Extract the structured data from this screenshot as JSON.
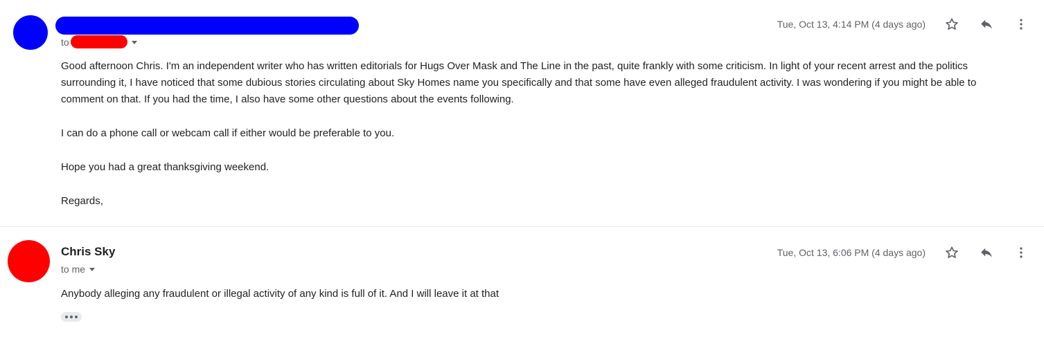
{
  "messages": [
    {
      "avatar_color": "#0000ff",
      "redaction_name_color": "#0000ff",
      "redaction_recipient_color": "#ff0000",
      "to_prefix": "to",
      "date": "Tue, Oct 13, 4:14 PM (4 days ago)",
      "paragraphs": [
        "Good afternoon Chris. I'm an independent writer who has written editorials for Hugs Over Mask and The Line in the past, quite frankly with some criticism. In light of your recent arrest and the politics surrounding it, I have noticed that some dubious stories circulating about Sky Homes name you specifically and that some have even alleged fraudulent activity. I was wondering if you might be able to comment on that. If you had the time, I also have some other questions about the events following.",
        "I can do a phone call or webcam call if either would be preferable to you.",
        "Hope you had a great thanksgiving weekend.",
        "Regards,"
      ],
      "icons": [
        "star-icon",
        "reply-icon",
        "more-vert-icon"
      ]
    },
    {
      "avatar_color": "#ff0000",
      "sender": "Chris Sky",
      "to_label": "to me",
      "date": "Tue, Oct 13, 6:06 PM (4 days ago)",
      "paragraphs": [
        "Anybody alleging any fraudulent or illegal activity of any kind is full of it.  And I will leave it at that"
      ],
      "icons": [
        "star-icon",
        "reply-icon",
        "more-vert-icon",
        "show-trimmed-content-icon"
      ]
    }
  ]
}
